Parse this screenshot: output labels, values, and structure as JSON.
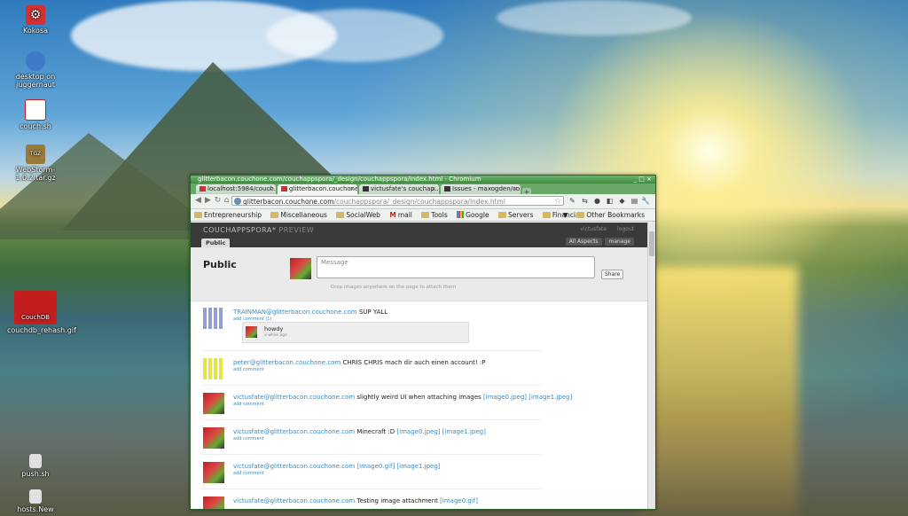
{
  "desktop": {
    "icons": [
      {
        "label": "Kokosa",
        "icon": "gear-icon",
        "color": "#d62f2f"
      },
      {
        "label": "desktop on juggernaut",
        "icon": "network-folder-icon",
        "color": "#3f79c9"
      },
      {
        "label": "couch.sh",
        "icon": "couchdb-script-icon",
        "color": "#c21e1e"
      },
      {
        "label": "WebStorm-1.0.2.tar.gz",
        "icon": "archive-icon",
        "color": "#9a7a3b"
      },
      {
        "label": "couchdb_rehash.gif",
        "icon": "couchdb-logo-icon",
        "color": "#c21e1e"
      },
      {
        "label": "push.sh",
        "icon": "script-icon",
        "color": "#d9d9d9"
      },
      {
        "label": "hosts.New",
        "icon": "script-icon",
        "color": "#d9d9d9"
      }
    ]
  },
  "browser": {
    "window_title": "glitterbacon.couchone.com/couchappspora/_design/couchappspora/index.html - Chromium",
    "tabs": [
      {
        "label": "localhost:5984/couch...",
        "active": false,
        "icon": "couch"
      },
      {
        "label": "glitterbacon.couchone...",
        "active": true,
        "icon": "couch"
      },
      {
        "label": "victusfate's couchap...",
        "active": false,
        "icon": "github"
      },
      {
        "label": "Issues - maxogden/co...",
        "active": false,
        "icon": "github"
      }
    ],
    "url_host": "glitterbacon.couchone.com",
    "url_path": "/couchappspora/_design/couchappspora/index.html",
    "bookmarks": [
      {
        "label": "Entrepreneurship",
        "type": "folder"
      },
      {
        "label": "Miscellaneous",
        "type": "folder"
      },
      {
        "label": "SocialWeb",
        "type": "folder"
      },
      {
        "label": "mail",
        "type": "gmail"
      },
      {
        "label": "Tools",
        "type": "folder"
      },
      {
        "label": "Google",
        "type": "google"
      },
      {
        "label": "Servers",
        "type": "folder"
      },
      {
        "label": "Financial",
        "type": "folder"
      }
    ],
    "other_bookmarks": "Other Bookmarks"
  },
  "app": {
    "brand": "COUCHAPPSPORA*",
    "brand_suffix": "PREVIEW",
    "user": "victusfate",
    "logout": "logout",
    "aspect_tab": "Public",
    "all_aspects": "All Aspects",
    "manage": "manage",
    "publisher": {
      "title": "Public",
      "placeholder": "Message",
      "share_label": "Share",
      "drop_hint": "Drop images anywhere on the page to attach them"
    },
    "posts": [
      {
        "author": "TRAINMAN@glitterbacon.couchone.com",
        "text": "SUP YALL",
        "sub": "add comment (1)",
        "avatar": "grid",
        "comment": {
          "text": "howdy",
          "time": "a while ago"
        }
      },
      {
        "author": "peter@glitterbacon.couchone.com",
        "text": "CHRIS CHRIS mach dir auch einen account! :P",
        "sub": "add comment",
        "avatar": "yellow"
      },
      {
        "author": "victusfate@glitterbacon.couchone.com",
        "text": "slightly weird UI when attaching images",
        "images": [
          "[image0.jpeg]",
          "[image1.jpeg]"
        ],
        "sub": "add comment",
        "avatar": "photo"
      },
      {
        "author": "victusfate@glitterbacon.couchone.com",
        "text": "Minecraft :D",
        "images": [
          "[image0.jpeg]",
          "[image1.jpeg]"
        ],
        "sub": "add comment",
        "avatar": "photo"
      },
      {
        "author": "victusfate@glitterbacon.couchone.com",
        "text": "",
        "images": [
          "[image0.gif]",
          "[image1.jpeg]"
        ],
        "sub": "add comment",
        "avatar": "photo"
      },
      {
        "author": "victusfate@glitterbacon.couchone.com",
        "text": "Testing image attachment",
        "images": [
          "[image0.gif]"
        ],
        "sub": "add comment",
        "avatar": "photo"
      }
    ]
  }
}
